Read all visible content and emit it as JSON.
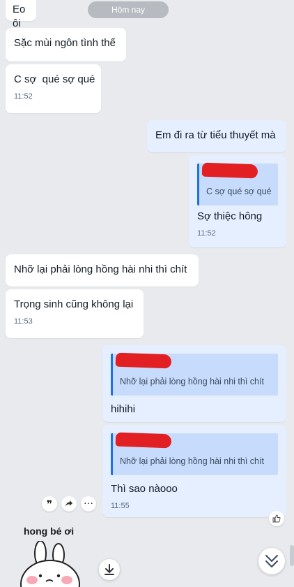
{
  "date_divider": "Hôm nay",
  "messages": {
    "m1": {
      "text": "Eo ôi"
    },
    "m2": {
      "text": "Sặc mùi ngôn tình thế"
    },
    "m3": {
      "text": "C sợ  qué sợ qué",
      "time": "11:52"
    },
    "m4": {
      "text": "Em đi ra từ tiểu thuyết mà"
    },
    "m5": {
      "quote": "C sợ qué sợ qué",
      "text": "Sợ thiệc hông",
      "time": "11:52"
    },
    "m6": {
      "text": "Nhỡ lại phải lòng hồng hài nhi thì chít"
    },
    "m7": {
      "text": "Trọng sinh cũng không lại",
      "time": "11:53"
    },
    "m8": {
      "quote": "Nhỡ lại phải lòng hồng hài nhi thì chít",
      "text": "hihihi"
    },
    "m9": {
      "quote": "Nhỡ lại phải lòng hồng hài nhi thì chít",
      "text": "Thì sao nàooo",
      "time": "11:55"
    }
  },
  "sticker": {
    "caption": "hong bé ơi"
  },
  "icons": {
    "quote": "quote-icon",
    "forward": "forward-icon",
    "more": "more-icon",
    "like": "like-icon",
    "download": "download-icon",
    "scroll_down": "chevron-double-down-icon"
  },
  "colors": {
    "background": "#e8eaee",
    "incoming_bubble": "#ffffff",
    "outgoing_bubble": "#e5efff",
    "quote_bar": "#1f6fe5",
    "quote_bg": "#c7dcfc",
    "redaction": "#e21f22"
  }
}
